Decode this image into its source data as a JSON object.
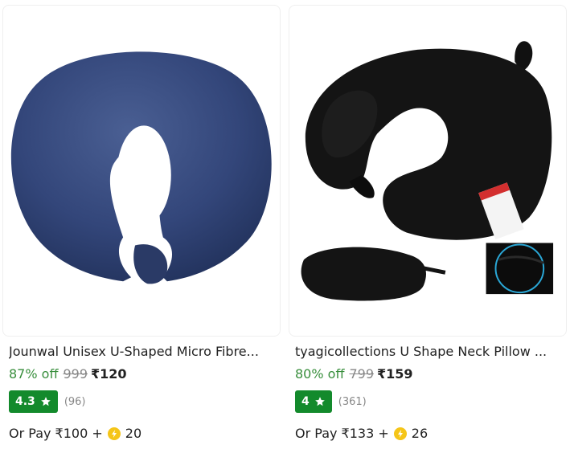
{
  "products": [
    {
      "title": "Jounwal Unisex U-Shaped Micro Fibre...",
      "discount": "87% off",
      "mrp": "999",
      "price": "₹120",
      "rating": "4.3",
      "rating_count": "(96)",
      "pay_prefix": "Or Pay ₹100 +",
      "coins": "20",
      "image_icon": "navy-neck-pillow-image"
    },
    {
      "title": "tyagicollections U Shape Neck Pillow ...",
      "discount": "80% off",
      "mrp": "799",
      "price": "₹159",
      "rating": "4",
      "rating_count": "(361)",
      "pay_prefix": "Or Pay ₹133 +",
      "coins": "26",
      "image_icon": "black-neck-pillow-with-eye-mask-image"
    }
  ],
  "colors": {
    "discount_green": "#388e3c",
    "rating_badge_green": "#138a2c",
    "coin_yellow": "#f5c518",
    "muted_gray": "#878787"
  },
  "icons": {
    "rating": "star-icon",
    "coin": "supercoin-icon"
  }
}
